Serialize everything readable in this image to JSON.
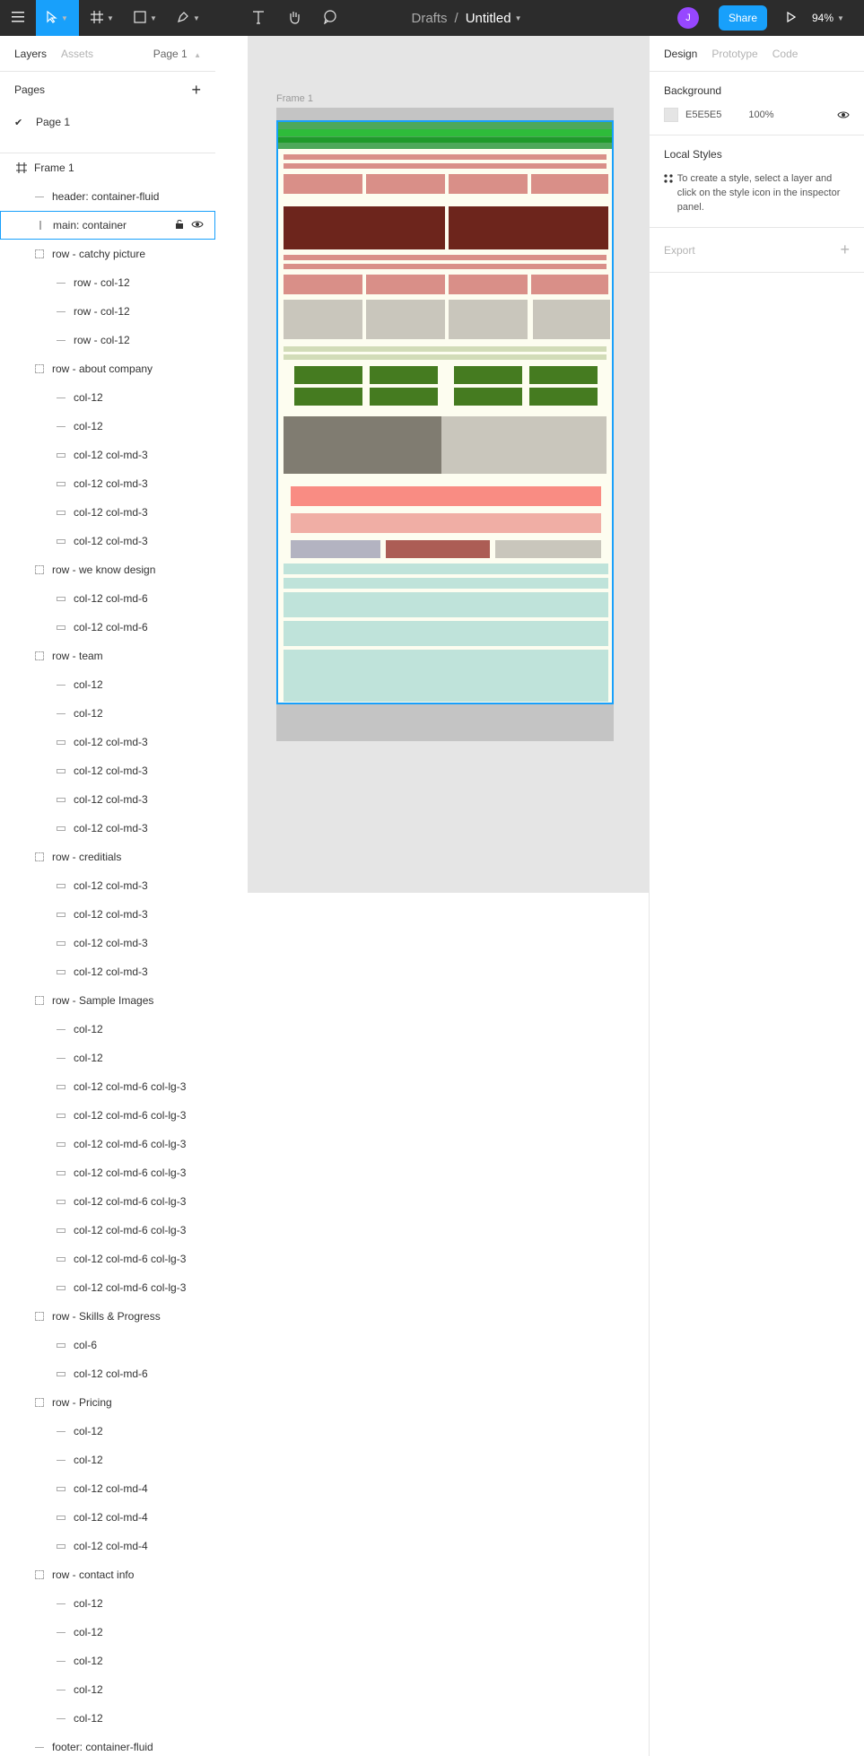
{
  "toolbar": {
    "breadcrumb_drafts": "Drafts",
    "breadcrumb_sep": "/",
    "file_title": "Untitled",
    "avatar_initial": "J",
    "share_label": "Share",
    "zoom_label": "94%"
  },
  "left_panel": {
    "tab_layers": "Layers",
    "tab_assets": "Assets",
    "page_selector": "Page 1",
    "pages_heading": "Pages",
    "pages": [
      "Page 1"
    ],
    "layers": [
      {
        "label": "Frame 1"
      },
      {
        "label": "header: container-fluid"
      },
      {
        "label": "main: container"
      },
      {
        "label": "row - catchy picture"
      },
      {
        "label": "row - col-12"
      },
      {
        "label": "row - col-12"
      },
      {
        "label": "row - col-12"
      },
      {
        "label": "row - about company"
      },
      {
        "label": "col-12"
      },
      {
        "label": "col-12"
      },
      {
        "label": "col-12 col-md-3"
      },
      {
        "label": "col-12 col-md-3"
      },
      {
        "label": "col-12 col-md-3"
      },
      {
        "label": "col-12 col-md-3"
      },
      {
        "label": "row - we know design"
      },
      {
        "label": "col-12 col-md-6"
      },
      {
        "label": "col-12 col-md-6"
      },
      {
        "label": "row - team"
      },
      {
        "label": "col-12"
      },
      {
        "label": "col-12"
      },
      {
        "label": "col-12 col-md-3"
      },
      {
        "label": "col-12 col-md-3"
      },
      {
        "label": "col-12 col-md-3"
      },
      {
        "label": "col-12 col-md-3"
      },
      {
        "label": "row - creditials"
      },
      {
        "label": "col-12 col-md-3"
      },
      {
        "label": "col-12 col-md-3"
      },
      {
        "label": "col-12 col-md-3"
      },
      {
        "label": "col-12 col-md-3"
      },
      {
        "label": "row - Sample Images"
      },
      {
        "label": "col-12"
      },
      {
        "label": "col-12"
      },
      {
        "label": "col-12 col-md-6 col-lg-3"
      },
      {
        "label": "col-12 col-md-6 col-lg-3"
      },
      {
        "label": "col-12 col-md-6 col-lg-3"
      },
      {
        "label": "col-12 col-md-6 col-lg-3"
      },
      {
        "label": "col-12 col-md-6 col-lg-3"
      },
      {
        "label": "col-12 col-md-6 col-lg-3"
      },
      {
        "label": "col-12 col-md-6 col-lg-3"
      },
      {
        "label": "col-12 col-md-6 col-lg-3"
      },
      {
        "label": "row - Skills & Progress"
      },
      {
        "label": "col-6"
      },
      {
        "label": "col-12 col-md-6"
      },
      {
        "label": "row - Pricing"
      },
      {
        "label": "col-12"
      },
      {
        "label": "col-12"
      },
      {
        "label": "col-12 col-md-4"
      },
      {
        "label": "col-12 col-md-4"
      },
      {
        "label": "col-12 col-md-4"
      },
      {
        "label": "row - contact info"
      },
      {
        "label": "col-12"
      },
      {
        "label": "col-12"
      },
      {
        "label": "col-12"
      },
      {
        "label": "col-12"
      },
      {
        "label": "col-12"
      },
      {
        "label": "footer: container-fluid"
      }
    ]
  },
  "canvas": {
    "frame_label": "Frame 1",
    "background_color": "#E5E5E5"
  },
  "right_panel": {
    "tab_design": "Design",
    "tab_prototype": "Prototype",
    "tab_code": "Code",
    "background_heading": "Background",
    "background_hex": "E5E5E5",
    "background_opacity": "100%",
    "local_styles_heading": "Local Styles",
    "local_styles_hint": "To create a style, select a layer and click on the style icon in the inspector panel.",
    "export_heading": "Export"
  },
  "help_label": "?"
}
